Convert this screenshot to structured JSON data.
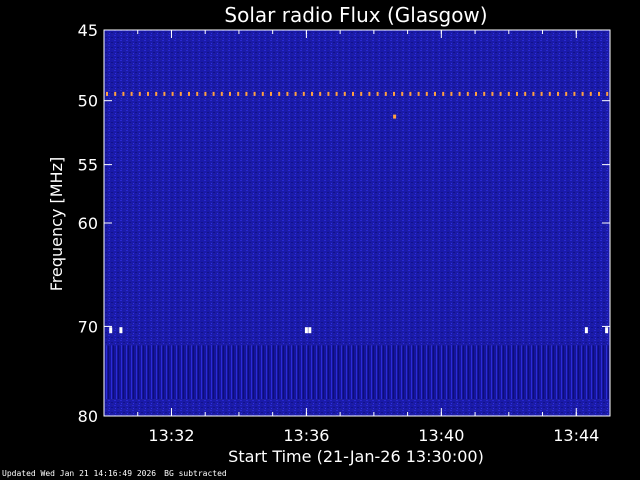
{
  "chart_data": {
    "type": "heatmap",
    "title": "Solar radio Flux (Glasgow)",
    "xlabel": "Start Time (21-Jan-26 13:30:00)",
    "ylabel": "Frequency [MHz]",
    "x_range_minutes": [
      0,
      15
    ],
    "x_ticks": [
      {
        "minute": 2,
        "label": "13:32"
      },
      {
        "minute": 6,
        "label": "13:36"
      },
      {
        "minute": 10,
        "label": "13:40"
      },
      {
        "minute": 14,
        "label": "13:44"
      }
    ],
    "y_range_mhz": [
      45,
      80
    ],
    "y_scale": "log",
    "y_ticks": [
      {
        "mhz": 45,
        "label": "45"
      },
      {
        "mhz": 50,
        "label": "50"
      },
      {
        "mhz": 55,
        "label": "55"
      },
      {
        "mhz": 60,
        "label": "60"
      },
      {
        "mhz": 70,
        "label": "70"
      },
      {
        "mhz": 80,
        "label": "80"
      }
    ],
    "interference_line_mhz": 49.5,
    "interference_spot": {
      "minute": 8.6,
      "mhz": 51.2
    },
    "white_markers": [
      {
        "minute": 0.2,
        "mhz": 70.4
      },
      {
        "minute": 0.5,
        "mhz": 70.4
      },
      {
        "minute": 6.0,
        "mhz": 70.4
      },
      {
        "minute": 6.1,
        "mhz": 70.4
      },
      {
        "minute": 14.3,
        "mhz": 70.4
      },
      {
        "minute": 14.9,
        "mhz": 70.4
      }
    ],
    "noisy_band_mhz": [
      72,
      78
    ],
    "colors": {
      "background": "#000000",
      "plot_background": "#1a1aa8",
      "interference": "#ffa040",
      "text": "#ffffff"
    }
  },
  "footer": {
    "updated": "Updated Wed Jan 21 14:16:49 2026",
    "note": "BG subtracted"
  }
}
